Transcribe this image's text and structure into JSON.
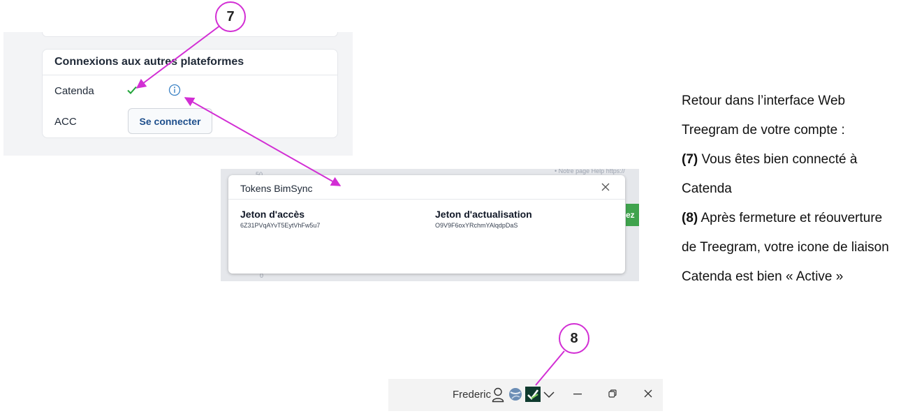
{
  "connections": {
    "title": "Connexions aux autres plateformes",
    "rows": [
      {
        "name": "Catenda",
        "status": "connected"
      },
      {
        "name": "ACC",
        "button_label": "Se connecter"
      }
    ]
  },
  "tokens_modal": {
    "title": "Tokens BimSync",
    "access_token_label": "Jeton d'accès",
    "access_token_value": "6Z31PVqAYvT5EytVhFw5u7",
    "refresh_token_label": "Jeton d'actualisation",
    "refresh_token_value": "O9V9F6oxYRchmYAlqdpDaS"
  },
  "background_fragments": {
    "help_text": "• Notre page Help https://",
    "axis_top": "50",
    "axis_bottom": "0",
    "green_button_fragment": "ez"
  },
  "callouts": {
    "seven": "7",
    "eight": "8"
  },
  "instructions": {
    "line1": "Retour dans l’interface Web",
    "line2": "Treegram de votre compte :",
    "step7_num": "(7)",
    "step7_text": " Vous êtes bien connecté à",
    "line4": "Catenda",
    "step8_num": "(8)",
    "step8_text": " Après fermeture et réouverture",
    "line6": "de Treegram, votre icone de liaison",
    "line7": "Catenda est bien « Active »"
  },
  "titlebar": {
    "user_name": "Frederic"
  },
  "colors": {
    "callout": "#d22ed4",
    "check": "#22a53a",
    "info": "#3b82c4",
    "link_button_text": "#1e4f8c",
    "catenda_icon": "#0f3a2e"
  },
  "icons": [
    "check-icon",
    "info-icon",
    "close-icon",
    "user-icon",
    "globe-icon",
    "catenda-icon",
    "chevron-down-icon",
    "minimize-icon",
    "restore-icon"
  ]
}
